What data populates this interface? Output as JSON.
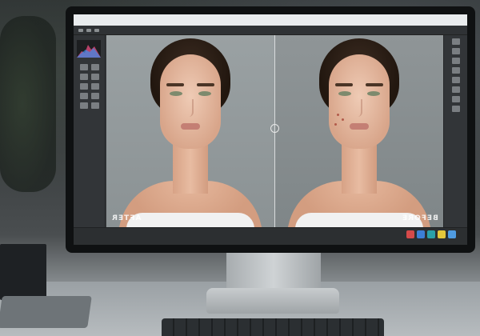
{
  "app": {
    "menubar_items": [
      "",
      "",
      "",
      "",
      "",
      "",
      "",
      ""
    ]
  },
  "canvas": {
    "left_label": "AFTER",
    "right_label": "BEFORE"
  },
  "status": {
    "info": ""
  },
  "taskbar_colors": [
    "#d54a4a",
    "#3c7fd6",
    "#2aa0a8",
    "#e3c63a",
    "#4f9be0"
  ]
}
